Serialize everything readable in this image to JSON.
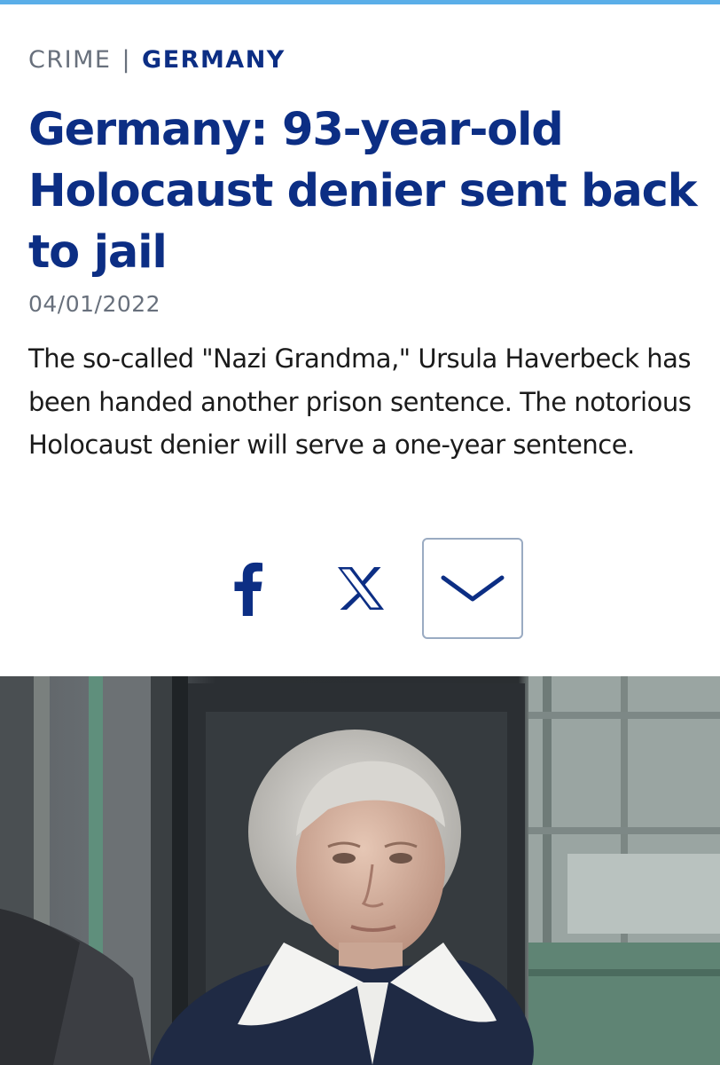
{
  "colors": {
    "accent_bar": "#5aaee8",
    "brand_blue": "#0c2e84",
    "muted_gray": "#68707c",
    "body_text": "#1b1b1b",
    "button_border": "#9aabc2"
  },
  "article": {
    "kicker": {
      "section": "CRIME",
      "separator": "|",
      "country": "GERMANY"
    },
    "headline": "Germany: 93-year-old Holocaust denier sent back to jail",
    "date": "04/01/2022",
    "teaser": "The so-called \"Nazi Grandma,\" Ursula Haverbeck has been handed another prison sentence. The notorious Holocaust denier will serve a one-year sentence."
  },
  "share": {
    "facebook_icon": "facebook-icon",
    "x_icon": "x-icon",
    "more_icon": "chevron-down-icon"
  },
  "photo": {
    "subject": "elderly-woman-portrait"
  }
}
